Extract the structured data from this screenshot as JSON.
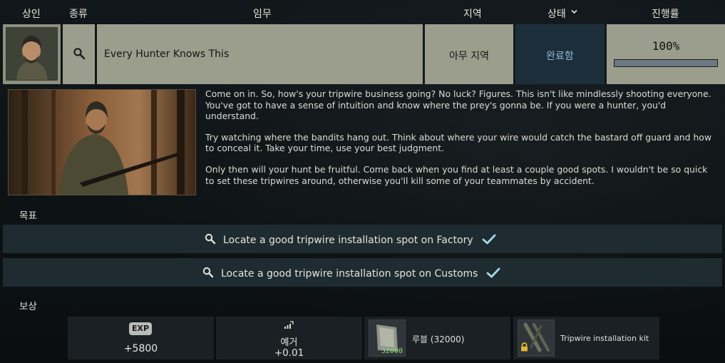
{
  "header": {
    "trader": "상인",
    "type": "종류",
    "task": "임무",
    "location": "지역",
    "status": "상태",
    "progress": "진행률"
  },
  "quest": {
    "title": "Every Hunter Knows This",
    "location": "아무 지역",
    "status": "완료함",
    "progress_text": "100%",
    "progress_value": 100
  },
  "description": [
    "Come on in. So, how's your tripwire business going? No luck? Figures. This isn't like mindlessly shooting everyone. You've got to have a sense of intuition and know where the prey's gonna be. If you were a hunter, you'd understand.",
    "Try watching where the bandits hang out. Think about where your wire would catch the bastard off guard and how to conceal it. Take your time, use your best judgment.",
    "Only then will your hunt be fruitful. Come back when you find at least a couple good spots. I wouldn't be so quick to set these tripwires around, otherwise you'll kill some of your teammates by accident."
  ],
  "objectives_title": "목표",
  "objectives": [
    {
      "text": "Locate a good tripwire installation spot on Factory",
      "completed": true
    },
    {
      "text": "Locate a good tripwire installation spot on Customs",
      "completed": true
    }
  ],
  "rewards_title": "보상",
  "rewards": {
    "exp": {
      "badge": "EXP",
      "value": "+5800"
    },
    "rep": {
      "name": "예거",
      "value": "+0.01"
    },
    "money": {
      "label": "루블 (32000)",
      "stack": "32000"
    },
    "item": {
      "label": "Tripwire installation kit"
    }
  },
  "colors": {
    "accent": "#8fbad8",
    "check": "#a9d8ec",
    "cell_bg": "#9c9e8d",
    "status_bg": "#1c2e39"
  },
  "icons": {
    "type": "search-icon",
    "sort": "chevron-down-icon",
    "objective": "search-icon",
    "complete": "checkmark-icon",
    "rep": "reputation-icon",
    "lock": "lock-icon"
  }
}
